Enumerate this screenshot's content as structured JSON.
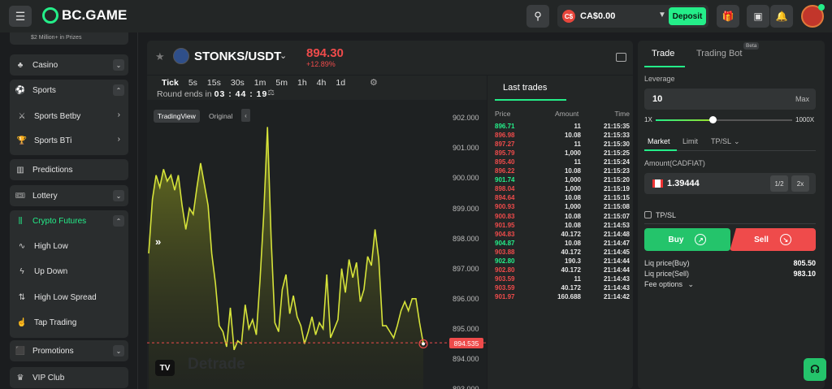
{
  "header": {
    "brand": "BC.GAME",
    "currency_badge": "C$",
    "balance": "CA$0.00",
    "deposit_label": "Deposit"
  },
  "sidebar": {
    "prize_text": "$2 Million+ in Prizes",
    "casino": "Casino",
    "sports": "Sports",
    "sports_betby": "Sports Betby",
    "sports_bti": "Sports BTi",
    "predictions": "Predictions",
    "lottery": "Lottery",
    "crypto_futures": "Crypto Futures",
    "high_low": "High Low",
    "up_down": "Up Down",
    "high_low_spread": "High Low Spread",
    "tap_trading": "Tap Trading",
    "promotions": "Promotions",
    "vip_club": "VIP Club"
  },
  "market": {
    "pair": "STONKS/USDT",
    "price": "894.30",
    "change": "+12.89%",
    "timeframes": [
      "Tick",
      "5s",
      "15s",
      "30s",
      "1m",
      "5m",
      "1h",
      "4h",
      "1d"
    ],
    "active_timeframe": "Tick",
    "round_label": "Round ends in",
    "round_time": "03 : 44 : 19",
    "chart_tab_tv": "TradingView",
    "chart_tab_orig": "Original",
    "watermark": "Detrade",
    "tv_logo": "TV"
  },
  "chart_data": {
    "type": "area",
    "ylim": [
      893,
      902.6
    ],
    "y_ticks": [
      "902.000",
      "901.000",
      "900.000",
      "899.000",
      "898.000",
      "897.000",
      "896.000",
      "895.000",
      "894.000",
      "893.000"
    ],
    "last_price_tag": "894.535",
    "series": [
      {
        "values": [
          897.5,
          899.3,
          900.1,
          899.7,
          900.3,
          899.9,
          900.1,
          899.6,
          900.1,
          899.1,
          898.3,
          899.0,
          898.8,
          899.7,
          900.5,
          899.8,
          899.1,
          897.5,
          896.5,
          895.1,
          894.9,
          894.4,
          895.7,
          894.3,
          894.6,
          894.5,
          895.8,
          895.0,
          895.3,
          894.8,
          896.6,
          898.8,
          901.7,
          898.0,
          895.2,
          894.9,
          896.3,
          896.8,
          895.5,
          896.1,
          895.4,
          895.1,
          894.5,
          894.9,
          895.4,
          894.8,
          895.2,
          895.0,
          896.8,
          894.7,
          895.0,
          895.3,
          897.0,
          896.2,
          897.3,
          896.7,
          897.2,
          895.9,
          896.3,
          897.4,
          897.1,
          898.3,
          897.3,
          895.1,
          895.1,
          894.9,
          894.7,
          895.1,
          895.6,
          895.9,
          895.6,
          896.0,
          896.0,
          895.2,
          894.5
        ]
      }
    ]
  },
  "last_trades": {
    "title": "Last trades",
    "headers": [
      "Price",
      "Amount",
      "Time"
    ],
    "rows": [
      {
        "price": "896.71",
        "amount": "11",
        "time": "21:15:35",
        "dir": "up"
      },
      {
        "price": "896.98",
        "amount": "10.08",
        "time": "21:15:33",
        "dir": "dn"
      },
      {
        "price": "897.27",
        "amount": "11",
        "time": "21:15:30",
        "dir": "dn"
      },
      {
        "price": "895.79",
        "amount": "1,000",
        "time": "21:15:25",
        "dir": "dn"
      },
      {
        "price": "895.40",
        "amount": "11",
        "time": "21:15:24",
        "dir": "dn"
      },
      {
        "price": "896.22",
        "amount": "10.08",
        "time": "21:15:23",
        "dir": "dn"
      },
      {
        "price": "901.74",
        "amount": "1,000",
        "time": "21:15:20",
        "dir": "up"
      },
      {
        "price": "898.04",
        "amount": "1,000",
        "time": "21:15:19",
        "dir": "dn"
      },
      {
        "price": "894.64",
        "amount": "10.08",
        "time": "21:15:15",
        "dir": "dn"
      },
      {
        "price": "900.93",
        "amount": "1,000",
        "time": "21:15:08",
        "dir": "dn"
      },
      {
        "price": "900.83",
        "amount": "10.08",
        "time": "21:15:07",
        "dir": "dn"
      },
      {
        "price": "901.95",
        "amount": "10.08",
        "time": "21:14:53",
        "dir": "dn"
      },
      {
        "price": "904.83",
        "amount": "40.172",
        "time": "21:14:48",
        "dir": "dn"
      },
      {
        "price": "904.87",
        "amount": "10.08",
        "time": "21:14:47",
        "dir": "up"
      },
      {
        "price": "903.88",
        "amount": "40.172",
        "time": "21:14:45",
        "dir": "dn"
      },
      {
        "price": "902.80",
        "amount": "190.3",
        "time": "21:14:44",
        "dir": "up"
      },
      {
        "price": "902.80",
        "amount": "40.172",
        "time": "21:14:44",
        "dir": "dn"
      },
      {
        "price": "903.59",
        "amount": "11",
        "time": "21:14:43",
        "dir": "dn"
      },
      {
        "price": "903.59",
        "amount": "40.172",
        "time": "21:14:43",
        "dir": "dn"
      },
      {
        "price": "901.97",
        "amount": "160.688",
        "time": "21:14:42",
        "dir": "dn"
      }
    ]
  },
  "trade": {
    "tab_trade": "Trade",
    "tab_bot": "Trading Bot",
    "beta": "Beta",
    "leverage_label": "Leverage",
    "leverage_value": "10",
    "leverage_max": "Max",
    "slider_min": "1X",
    "slider_max": "1000X",
    "slider_fraction": 0.01,
    "order_tabs": [
      "Market",
      "Limit",
      "TP/SL"
    ],
    "amount_label": "Amount(CADFIAT)",
    "amount_value": "1.39444",
    "half": "1/2",
    "double": "2x",
    "tpsl": "TP/SL",
    "buy": "Buy",
    "sell": "Sell",
    "liq_buy_label": "Liq price(Buy)",
    "liq_buy_value": "805.50",
    "liq_sell_label": "Liq price(Sell)",
    "liq_sell_value": "983.10",
    "fee_options": "Fee options"
  },
  "colors": {
    "accent": "#24ee89",
    "up": "#24ee89",
    "down": "#ef4b4b",
    "line": "#d6e33a"
  }
}
